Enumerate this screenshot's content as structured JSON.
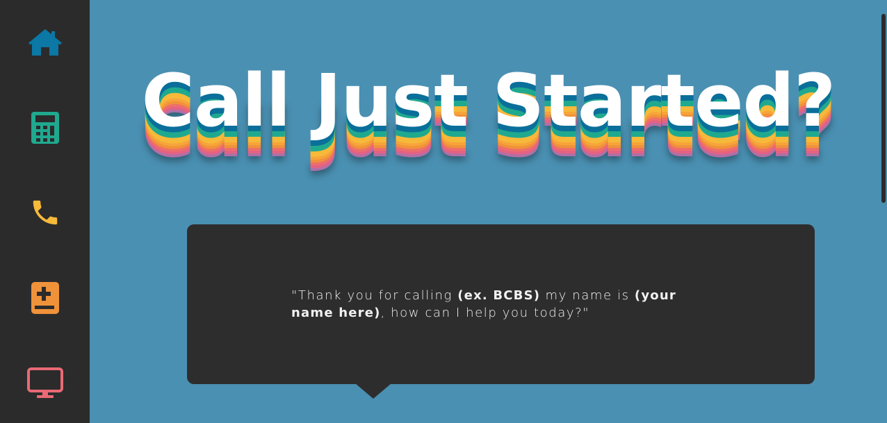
{
  "sidebar": {
    "items": [
      {
        "icon": "home-icon",
        "color": "#0b78a6"
      },
      {
        "icon": "calculator-icon",
        "color": "#1fa98f"
      },
      {
        "icon": "phone-icon",
        "color": "#f6b93a"
      },
      {
        "icon": "medical-book-icon",
        "color": "#f0923a"
      },
      {
        "icon": "monitor-icon",
        "color": "#e96a74"
      }
    ]
  },
  "main": {
    "title": "Call Just Started?",
    "script": {
      "part1": "\"Thank you for calling ",
      "company_placeholder": "(ex. BCBS)",
      "part2": " my name is ",
      "name_placeholder": "(your name here)",
      "part3": ", how can I help you today?\""
    }
  },
  "colors": {
    "background": "#4a90b2",
    "sidebar": "#2b2b2c",
    "card": "#2e2d2e"
  }
}
